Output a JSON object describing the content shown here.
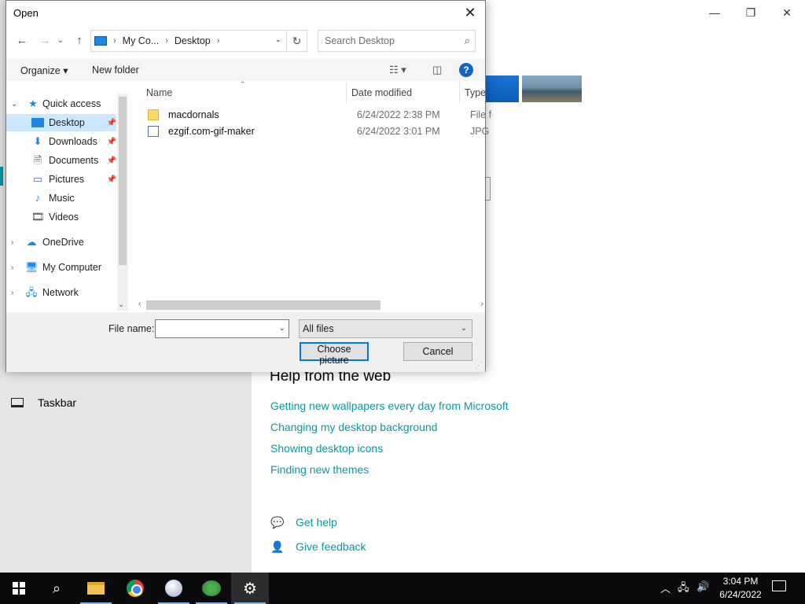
{
  "settings": {
    "window_controls": {
      "minimize": "—",
      "restore": "❐",
      "close": "✕"
    },
    "taskbar_label": "Taskbar",
    "help_title": "Help from the web",
    "help_links": [
      "Getting new wallpapers every day from Microsoft",
      "Changing my desktop background",
      "Showing desktop icons",
      "Finding new themes"
    ],
    "get_help": "Get help",
    "give_feedback": "Give feedback",
    "accent_color": "#0a97a8"
  },
  "dialog": {
    "title": "Open",
    "close_glyph": "✕",
    "nav": {
      "back": "←",
      "forward": "→",
      "up": "↑",
      "refresh": "↻"
    },
    "breadcrumb": [
      "My Co...",
      "Desktop"
    ],
    "search_placeholder": "Search Desktop",
    "toolbar": {
      "organize": "Organize ▾",
      "new_folder": "New folder",
      "help": "?"
    },
    "nav_pane": {
      "quick_access": "Quick access",
      "items": [
        {
          "label": "Desktop",
          "icon": "desktop-icon",
          "pinned": true,
          "selected": true
        },
        {
          "label": "Downloads",
          "icon": "downloads-icon",
          "pinned": true
        },
        {
          "label": "Documents",
          "icon": "documents-icon",
          "pinned": true
        },
        {
          "label": "Pictures",
          "icon": "pictures-icon",
          "pinned": true
        },
        {
          "label": "Music",
          "icon": "music-icon",
          "pinned": false
        },
        {
          "label": "Videos",
          "icon": "videos-icon",
          "pinned": false
        }
      ],
      "onedrive": "OneDrive",
      "my_computer": "My Computer",
      "network": "Network"
    },
    "columns": {
      "name": "Name",
      "date": "Date modified",
      "type": "Type"
    },
    "files": [
      {
        "name": "macdornals",
        "date": "6/24/2022 2:38 PM",
        "type": "File folder",
        "icon": "folder-icon"
      },
      {
        "name": "ezgif.com-gif-maker",
        "date": "6/24/2022 3:01 PM",
        "type": "JPG File",
        "icon": "image-file-icon"
      }
    ],
    "file_name_label": "File name:",
    "file_name_value": "",
    "filter_value": "All files",
    "buttons": {
      "choose": "Choose picture",
      "cancel": "Cancel"
    }
  },
  "taskbar": {
    "clock_time": "3:04 PM",
    "clock_date": "6/24/2022",
    "apps": [
      "start",
      "search",
      "file-explorer",
      "chrome",
      "app-ball",
      "download-manager",
      "settings"
    ]
  }
}
